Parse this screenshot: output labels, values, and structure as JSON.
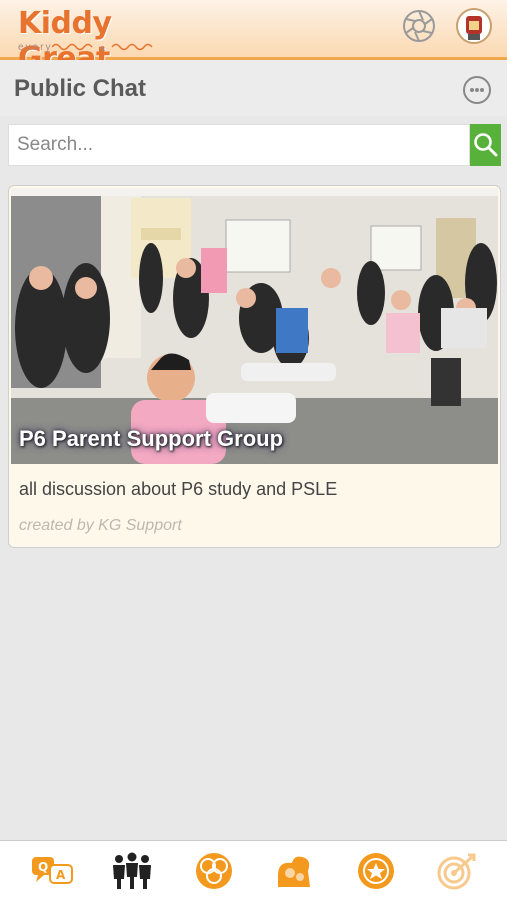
{
  "header": {
    "logo_text": "Kiddy Great",
    "logo_tagline": "every  ~~~~  a  ~~~~",
    "settings_icon": "aperture-gear-icon",
    "avatar_icon": "profile-avatar-icon"
  },
  "title_bar": {
    "title": "Public Chat",
    "more_icon": "more-options-icon"
  },
  "search": {
    "placeholder": "Search...",
    "value": "",
    "button_icon": "search-icon"
  },
  "groups": [
    {
      "name": "P6 Parent Support Group",
      "description": "all discussion about P6 study and PSLE",
      "creator": "created by KG Support",
      "image": "group-photo-classroom"
    }
  ],
  "bottom_nav": {
    "items": [
      {
        "name": "qa",
        "icon": "qa-bubbles-icon"
      },
      {
        "name": "community",
        "icon": "people-group-icon",
        "active": true
      },
      {
        "name": "circles",
        "icon": "circles-icon"
      },
      {
        "name": "rewards",
        "icon": "treasure-icon"
      },
      {
        "name": "badges",
        "icon": "star-badge-icon"
      },
      {
        "name": "goals",
        "icon": "target-icon"
      }
    ]
  },
  "colors": {
    "accent": "#f2a64d",
    "search_button": "#58b13a",
    "nav_icon": "#f39a1e",
    "nav_active": "#222222"
  }
}
